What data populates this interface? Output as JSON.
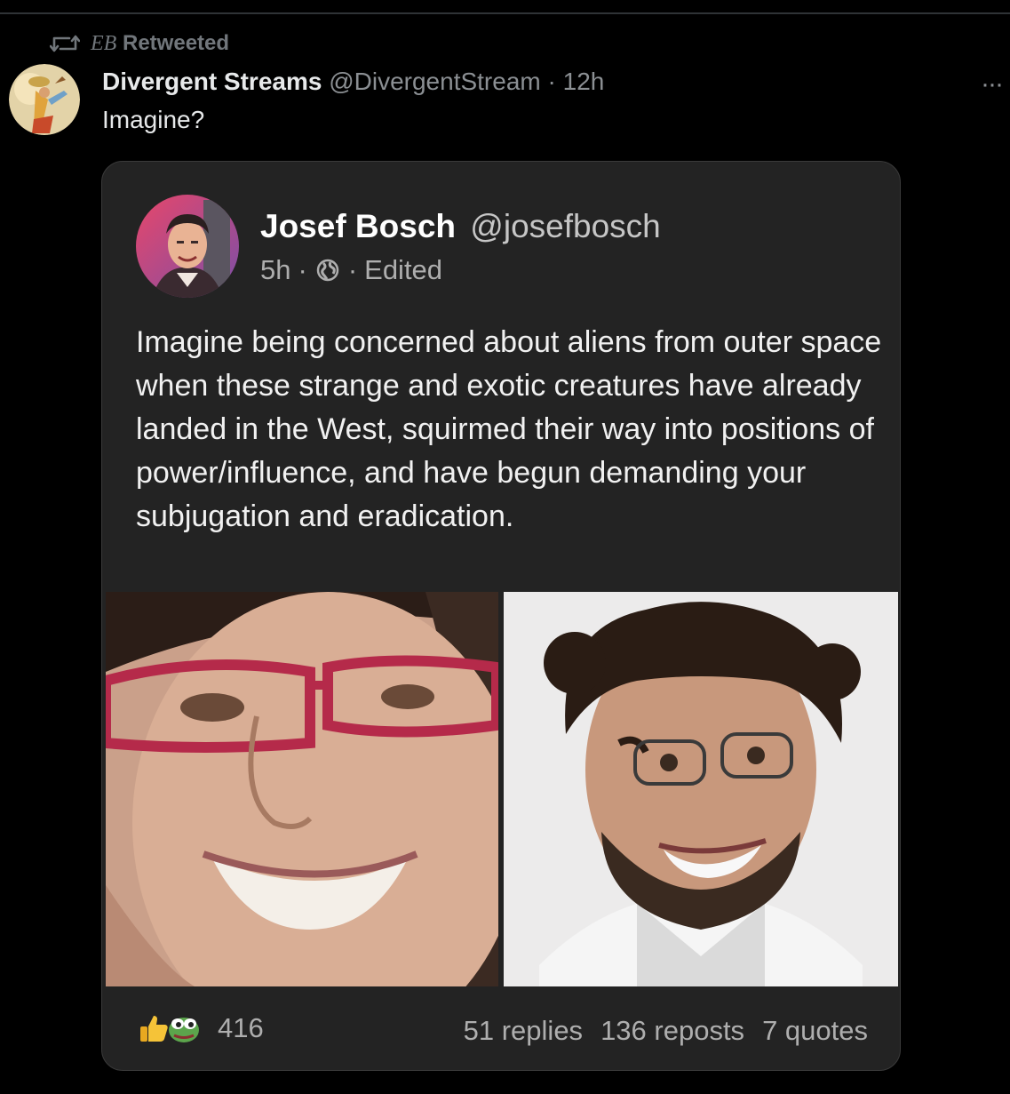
{
  "retweet": {
    "icon": "retweet-icon",
    "by": "EB",
    "label": "Retweeted"
  },
  "tweet": {
    "author_name": "Divergent Streams",
    "author_handle": "@DivergentStream",
    "separator": "·",
    "time": "12h",
    "text": "Imagine?",
    "more_icon": "more-options-icon",
    "more_glyph": "···"
  },
  "quoted_post": {
    "author_name": "Josef Bosch",
    "author_handle": "@josefbosch",
    "time": "5h",
    "separator": "·",
    "visibility_icon": "globe-icon",
    "edited_label": "Edited",
    "body": "Imagine being concerned about aliens from outer space when these strange and exotic creatures have already landed in the West, squirmed their way into positions of power/influence, and have begun demanding your subjugation and eradication.",
    "reaction_icons": [
      "thumbs-up-icon",
      "pepe-frog-icon"
    ],
    "reaction_count": "416",
    "replies": "51 replies",
    "reposts": "136 reposts",
    "quotes": "7 quotes"
  },
  "colors": {
    "background": "#000000",
    "card": "#232323",
    "muted_text": "#71767b",
    "primary_text": "#e7e9ea"
  }
}
